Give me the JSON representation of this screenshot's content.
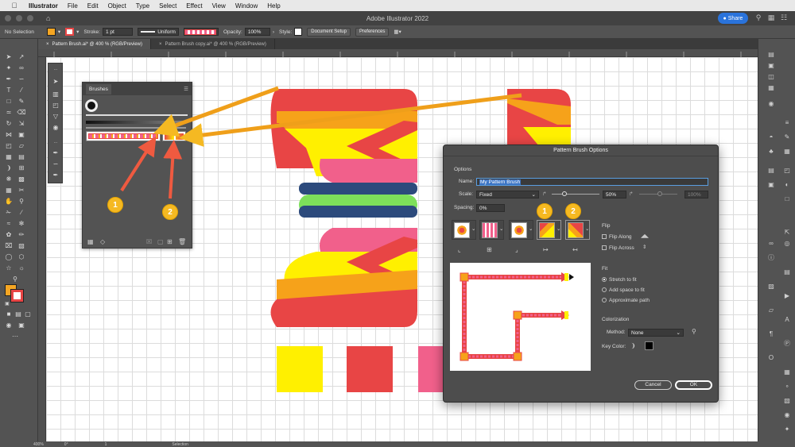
{
  "menubar": {
    "app": "Illustrator",
    "items": [
      "File",
      "Edit",
      "Object",
      "Type",
      "Select",
      "Effect",
      "View",
      "Window",
      "Help"
    ]
  },
  "titlebar": {
    "title": "Adobe Illustrator 2022",
    "share_label": "Share"
  },
  "controlbar": {
    "selection": "No Selection",
    "stroke_label": "Stroke:",
    "stroke_value": "1 pt",
    "profile": "Uniform",
    "opacity_label": "Opacity:",
    "opacity_value": "100%",
    "style_label": "Style:",
    "document_setup": "Document Setup",
    "preferences": "Preferences",
    "fill_color": "#f5a623",
    "stroke_color": "#e84545"
  },
  "doc_tabs": [
    {
      "label": "Pattern Brush.ai* @ 400 % (RGB/Preview)",
      "active": true
    },
    {
      "label": "Pattern Brush copy.ai* @ 400 % (RGB/Preview)",
      "active": false
    }
  ],
  "brushes_panel": {
    "title": "Brushes"
  },
  "dialog": {
    "title": "Pattern Brush Options",
    "options_label": "Options",
    "name_label": "Name:",
    "name_value": "My Pattern Brush",
    "scale_label": "Scale:",
    "scale_value": "Fixed",
    "scale_percent": "50%",
    "scale_percent_right": "100%",
    "spacing_label": "Spacing:",
    "spacing_value": "0%",
    "flip_label": "Flip",
    "flip_along": "Flip Along",
    "flip_across": "Flip Across",
    "fit_label": "Fit",
    "fit_options": [
      "Stretch to fit",
      "Add space to fit",
      "Approximate path"
    ],
    "colorization_label": "Colorization",
    "method_label": "Method:",
    "method_value": "None",
    "key_color_label": "Key Color:",
    "cancel": "Cancel",
    "ok": "OK"
  },
  "annotations": {
    "badge_1": "1",
    "badge_2": "2",
    "arrow_color": "#f5b922",
    "red_arrow_color": "#ef5a40"
  },
  "statusbar": {
    "zoom": "400%",
    "rotate": "0°",
    "artboard": "1",
    "mode": "Selection"
  },
  "artwork_colors": {
    "red": "#e84545",
    "orange": "#f6a21a",
    "yellow": "#fff000",
    "pink": "#f1608b",
    "navy": "#2c4a7c",
    "green": "#7ddf5a"
  }
}
